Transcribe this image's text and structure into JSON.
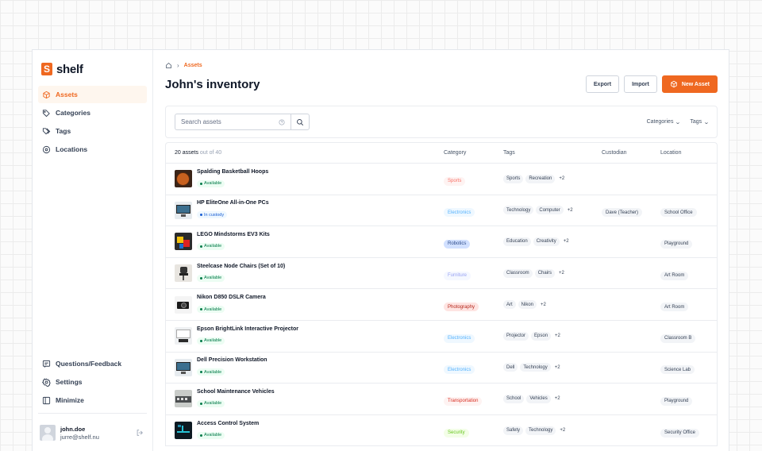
{
  "brand": {
    "logo_letter": "S",
    "name": "shelf",
    "color": "#ef6820"
  },
  "sidebar": {
    "items": [
      {
        "label": "Assets",
        "icon": "cube-icon",
        "active": true
      },
      {
        "label": "Categories",
        "icon": "tag-icon"
      },
      {
        "label": "Tags",
        "icon": "tags-icon"
      },
      {
        "label": "Locations",
        "icon": "map-pin-icon"
      }
    ],
    "bottom": [
      {
        "label": "Questions/Feedback",
        "icon": "message-icon"
      },
      {
        "label": "Settings",
        "icon": "gear-icon"
      },
      {
        "label": "Minimize",
        "icon": "sidebar-icon"
      }
    ],
    "user": {
      "name": "john.doe",
      "email": "jurre@shelf.nu"
    }
  },
  "breadcrumb": {
    "separator": "›",
    "current": "Assets"
  },
  "header": {
    "title": "John's inventory",
    "export_label": "Export",
    "import_label": "Import",
    "new_asset_label": "New Asset"
  },
  "search": {
    "placeholder": "Search assets",
    "value": ""
  },
  "filters": [
    {
      "label": "Categories",
      "chevron": "⌄"
    },
    {
      "label": "Tags",
      "chevron": "⌄"
    }
  ],
  "table": {
    "count": "20 assets",
    "count_suffix": " out of 40",
    "columns": {
      "category": "Category",
      "tags": "Tags",
      "custodian": "Custodian",
      "location": "Location"
    },
    "rows": [
      {
        "name": "Spalding Basketball Hoops",
        "status": "Available",
        "status_type": "available",
        "thumb": "basketball",
        "category": "Sports",
        "cat_bg": "#fef3f2",
        "cat_fg": "#f97066",
        "tags": [
          "Sports",
          "Recreation"
        ],
        "more": "+2",
        "custodian": "",
        "location": ""
      },
      {
        "name": "HP EliteOne All-in-One PCs",
        "status": "In custody",
        "status_type": "custody",
        "thumb": "computer",
        "category": "Electronics",
        "cat_bg": "#eff8ff",
        "cat_fg": "#53b1fd",
        "tags": [
          "Technology",
          "Computer"
        ],
        "more": "+2",
        "custodian": "Dave (Teacher)",
        "location": "School Office"
      },
      {
        "name": "LEGO Mindstorms EV3 Kits",
        "status": "Available",
        "status_type": "available",
        "thumb": "lego",
        "category": "Robotics",
        "cat_bg": "#d1e0ff",
        "cat_fg": "#2d4b8a",
        "tags": [
          "Education",
          "Creativity"
        ],
        "more": "+2",
        "custodian": "",
        "location": "Playground"
      },
      {
        "name": "Steelcase Node Chairs (Set of 10)",
        "status": "Available",
        "status_type": "available",
        "thumb": "chairs",
        "category": "Furniture",
        "cat_bg": "#f5f8ff",
        "cat_fg": "#98a2f3",
        "tags": [
          "Classroom",
          "Chairs"
        ],
        "more": "+2",
        "custodian": "",
        "location": "Art Room"
      },
      {
        "name": "Nikon D850 DSLR Camera",
        "status": "Available",
        "status_type": "available",
        "thumb": "camera",
        "category": "Photography",
        "cat_bg": "#fee4e2",
        "cat_fg": "#b42318",
        "tags": [
          "Art",
          "Nikon"
        ],
        "more": "+2",
        "custodian": "",
        "location": "Art Room"
      },
      {
        "name": "Epson BrightLink Interactive Projector",
        "status": "Available",
        "status_type": "available",
        "thumb": "projector",
        "category": "Electronics",
        "cat_bg": "#eff8ff",
        "cat_fg": "#53b1fd",
        "tags": [
          "Projector",
          "Epson"
        ],
        "more": "+2",
        "custodian": "",
        "location": "Classroom B"
      },
      {
        "name": "Dell Precision Workstation",
        "status": "Available",
        "status_type": "available",
        "thumb": "computer",
        "category": "Electronics",
        "cat_bg": "#eff8ff",
        "cat_fg": "#53b1fd",
        "tags": [
          "Dell",
          "Technology"
        ],
        "more": "+2",
        "custodian": "",
        "location": "Science Lab"
      },
      {
        "name": "School Maintenance Vehicles",
        "status": "Available",
        "status_type": "available",
        "thumb": "vehicles",
        "category": "Transportation",
        "cat_bg": "#fef3f2",
        "cat_fg": "#d92d20",
        "tags": [
          "School",
          "Vehicles"
        ],
        "more": "+2",
        "custodian": "",
        "location": "Playground"
      },
      {
        "name": "Access Control System",
        "status": "Available",
        "status_type": "available",
        "thumb": "security",
        "category": "Security",
        "cat_bg": "#f3fee7",
        "cat_fg": "#66c61c",
        "tags": [
          "Safety",
          "Technology"
        ],
        "more": "+2",
        "custodian": "",
        "location": "Security Office"
      }
    ]
  }
}
